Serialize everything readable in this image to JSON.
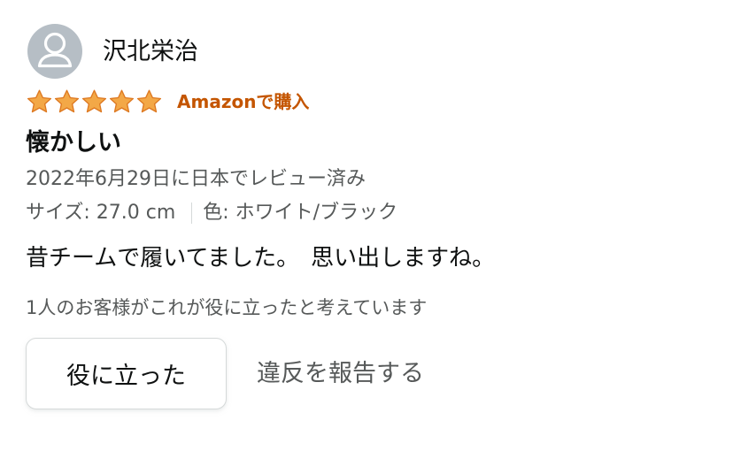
{
  "reviewer": {
    "name": "沢北栄治",
    "avatar_icon": "default-user-avatar-icon"
  },
  "rating": {
    "stars": 5,
    "max_stars": 5,
    "star_color": "#f3a847",
    "star_outline": "#de7921",
    "verified_label": "Amazonで購入",
    "verified_color": "#c45500"
  },
  "review": {
    "title": "懐かしい",
    "date": "2022年6月29日に日本でレビュー済み",
    "size_label": "サイズ: 27.0 cm",
    "color_label": "色: ホワイト/ブラック",
    "body": "昔チームで履いてました。　思い出しますね。"
  },
  "helpfulness": {
    "count_text": "1人のお客様がこれが役に立ったと考えています",
    "helpful_button_label": "役に立った",
    "report_link_label": "違反を報告する"
  }
}
